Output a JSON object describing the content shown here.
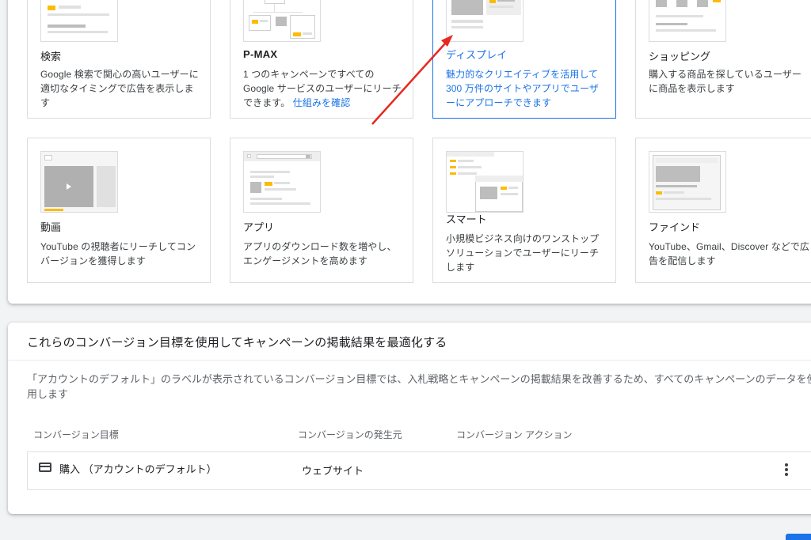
{
  "campaign_types": [
    {
      "id": "search",
      "title": "検索",
      "description": "Google 検索で関心の高いユーザーに適切なタイミングで広告を表示します"
    },
    {
      "id": "pmax",
      "title": "P-MAX",
      "description": "1 つのキャンペーンですべての Google サービスのユーザーにリーチできます。",
      "link": "仕組みを確認"
    },
    {
      "id": "display",
      "title": "ディスプレイ",
      "description": "魅力的なクリエイティブを活用して 300 万件のサイトやアプリでユーザーにアプローチできます",
      "selected": true
    },
    {
      "id": "shopping",
      "title": "ショッピング",
      "description": "購入する商品を探しているユーザーに商品を表示します"
    },
    {
      "id": "video",
      "title": "動画",
      "description": "YouTube の視聴者にリーチしてコンバージョンを獲得します"
    },
    {
      "id": "app",
      "title": "アプリ",
      "description": "アプリのダウンロード数を増やし、エンゲージメントを高めます"
    },
    {
      "id": "smart",
      "title": "スマート",
      "description": "小規模ビジネス向けのワンストップ ソリューションでユーザーにリーチします"
    },
    {
      "id": "discovery",
      "title": "ファインド",
      "description": "YouTube、Gmail、Discover などで広告を配信します"
    }
  ],
  "conversion_goals": {
    "title": "これらのコンバージョン目標を使用してキャンペーンの掲載結果を最適化する",
    "description": "「アカウントのデフォルト」のラベルが表示されているコンバージョン目標では、入札戦略とキャンペーンの掲載結果を改善するため、すべてのキャンペーンのデータを使用します",
    "columns": [
      "コンバージョン目標",
      "コンバージョンの発生元",
      "コンバージョン アクション"
    ],
    "rows": [
      {
        "goal": "購入 （アカウントのデフォルト）",
        "source": "ウェブサイト",
        "action": "",
        "icon": "credit-card-icon"
      }
    ]
  },
  "colors": {
    "accent": "#1a73e8",
    "highlight": "#fbbc04",
    "annotation_arrow": "#e8281e"
  }
}
